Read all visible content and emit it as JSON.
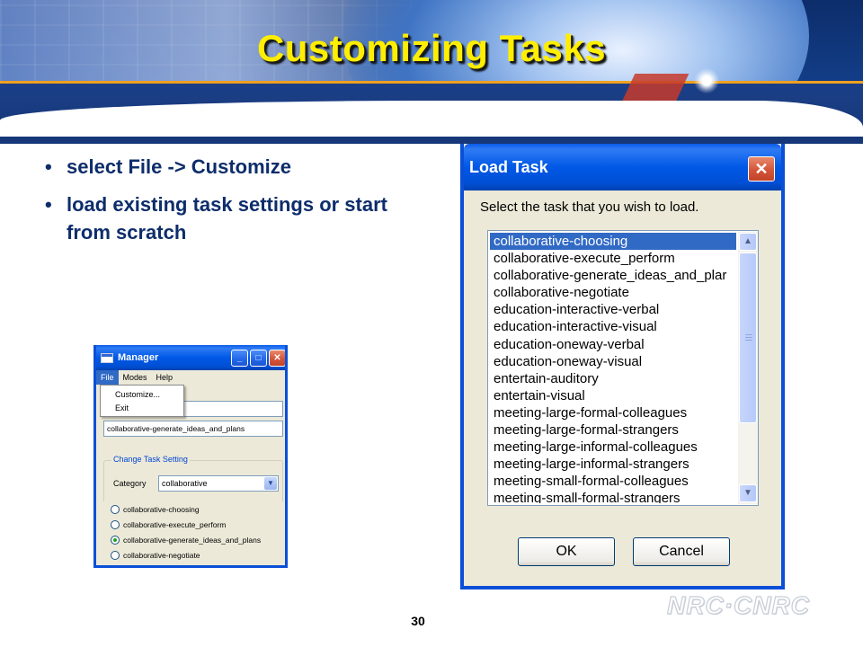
{
  "slide": {
    "title": "Customizing Tasks",
    "bullets": [
      "select File -> Customize",
      "load existing task settings or start from scratch"
    ],
    "page_number": "30",
    "logo_text": "NRC·CNRC"
  },
  "manager": {
    "title": "Manager",
    "window_buttons": {
      "minimize": "_",
      "maximize": "□",
      "close": "✕"
    },
    "menu": [
      "File",
      "Modes",
      "Help"
    ],
    "file_menu_items": [
      "Customize...",
      "Exit"
    ],
    "task_field_value": "collaborative-generate_ideas_and_plans",
    "group_label": "Change Task Setting",
    "category_label": "Category",
    "category_value": "collaborative",
    "radio_options": [
      "collaborative-choosing",
      "collaborative-execute_perform",
      "collaborative-generate_ideas_and_plans",
      "collaborative-negotiate"
    ],
    "selected_radio": 2
  },
  "load_task": {
    "title": "Load Task",
    "close_glyph": "✕",
    "prompt": "Select the task that you wish to load.",
    "items": [
      "collaborative-choosing",
      "collaborative-execute_perform",
      "collaborative-generate_ideas_and_plar",
      "collaborative-negotiate",
      "education-interactive-verbal",
      "education-interactive-visual",
      "education-oneway-verbal",
      "education-oneway-visual",
      "entertain-auditory",
      "entertain-visual",
      "meeting-large-formal-colleagues",
      "meeting-large-formal-strangers",
      "meeting-large-informal-colleagues",
      "meeting-large-informal-strangers",
      "meeting-small-formal-colleagues",
      "meeting-small-formal-strangers"
    ],
    "selected_index": 0,
    "scroll_up_glyph": "▲",
    "scroll_down_glyph": "▼",
    "ok_label": "OK",
    "cancel_label": "Cancel"
  },
  "colors": {
    "title_yellow": "#ffee00",
    "bullet_blue": "#0d2d6b",
    "xp_title_blue": "#0058e6",
    "selection_blue": "#316ac5"
  }
}
